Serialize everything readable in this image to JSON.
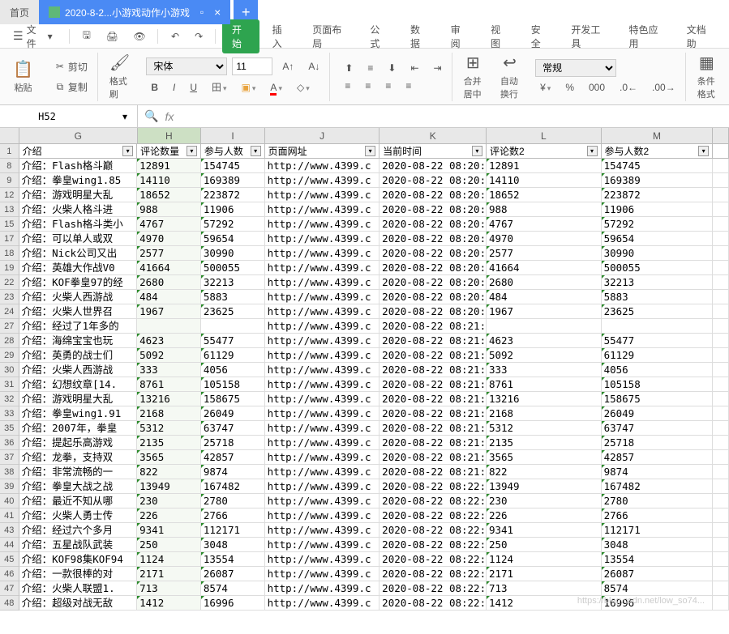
{
  "titlebar": {
    "home": "首页",
    "file_tab": "2020-8-2...小游戏动作小游戏",
    "add": "+"
  },
  "menubar": {
    "file": "文件",
    "start": "开始",
    "insert": "插入",
    "layout": "页面布局",
    "formula": "公式",
    "data": "数据",
    "review": "审阅",
    "view": "视图",
    "secure": "安全",
    "dev": "开发工具",
    "special": "特色应用",
    "dochelp": "文档助"
  },
  "ribbon": {
    "paste": "粘贴",
    "cut": "剪切",
    "copy": "复制",
    "format_painter": "格式刷",
    "font": "宋体",
    "size": "11",
    "merge": "合并居中",
    "wrap": "自动换行",
    "numfmt": "常规",
    "condfmt": "条件格式"
  },
  "formula_bar": {
    "name": "H52",
    "fx": "fx"
  },
  "columns": [
    "G",
    "H",
    "I",
    "J",
    "K",
    "L",
    "M",
    ""
  ],
  "headers": [
    "介绍",
    "评论数量",
    "参与人数",
    "页面网址",
    "当前时间",
    "评论数2",
    "参与人数2",
    ""
  ],
  "row_nums": [
    "1",
    "8",
    "9",
    "12",
    "13",
    "15",
    "17",
    "18",
    "19",
    "22",
    "23",
    "24",
    "27",
    "28",
    "29",
    "30",
    "31",
    "32",
    "33",
    "35",
    "36",
    "37",
    "38",
    "39",
    "40",
    "41",
    "43",
    "44",
    "45",
    "46",
    "47",
    "48"
  ],
  "chart_data": {
    "type": "table",
    "columns": [
      "介绍",
      "评论数量",
      "参与人数",
      "页面网址",
      "当前时间",
      "评论数2",
      "参与人数2"
    ],
    "rows": [
      [
        "介绍：Flash格斗巅",
        "12891",
        "154745",
        "http://www.4399.c",
        "2020-08-22 08:20:",
        "12891",
        "154745"
      ],
      [
        "介绍：拳皇wing1.85",
        "14110",
        "169389",
        "http://www.4399.c",
        "2020-08-22 08:20:",
        "14110",
        "169389"
      ],
      [
        "介绍：游戏明星大乱",
        "18652",
        "223872",
        "http://www.4399.c",
        "2020-08-22 08:20:",
        "18652",
        "223872"
      ],
      [
        "介绍：火柴人格斗进",
        "988",
        "11906",
        "http://www.4399.c",
        "2020-08-22 08:20:",
        "988",
        "11906"
      ],
      [
        "介绍：Flash格斗类小",
        "4767",
        "57292",
        "http://www.4399.c",
        "2020-08-22 08:20:",
        "4767",
        "57292"
      ],
      [
        "介绍：可以单人或双",
        "4970",
        "59654",
        "http://www.4399.c",
        "2020-08-22 08:20:",
        "4970",
        "59654"
      ],
      [
        "介绍：Nick公司又出",
        "2577",
        "30990",
        "http://www.4399.c",
        "2020-08-22 08:20:",
        "2577",
        "30990"
      ],
      [
        "介绍：英雄大作战V0",
        "41664",
        "500055",
        "http://www.4399.c",
        "2020-08-22 08:20:",
        "41664",
        "500055"
      ],
      [
        "介绍：KOF拳皇97的经",
        "2680",
        "32213",
        "http://www.4399.c",
        "2020-08-22 08:20:",
        "2680",
        "32213"
      ],
      [
        "介绍：火柴人西游战",
        "484",
        "5883",
        "http://www.4399.c",
        "2020-08-22 08:20:",
        "484",
        "5883"
      ],
      [
        "介绍：火柴人世界召",
        "1967",
        "23625",
        "http://www.4399.c",
        "2020-08-22 08:20:",
        "1967",
        "23625"
      ],
      [
        "介绍：经过了1年多的",
        "",
        "",
        "http://www.4399.c",
        "2020-08-22 08:21:",
        "",
        ""
      ],
      [
        "介绍：海绵宝宝也玩",
        "4623",
        "55477",
        "http://www.4399.c",
        "2020-08-22 08:21:",
        "4623",
        "55477"
      ],
      [
        "介绍：英勇的战士们",
        "5092",
        "61129",
        "http://www.4399.c",
        "2020-08-22 08:21:",
        "5092",
        "61129"
      ],
      [
        "介绍：火柴人西游战",
        "333",
        "4056",
        "http://www.4399.c",
        "2020-08-22 08:21:",
        "333",
        "4056"
      ],
      [
        "介绍：幻想纹章[14.",
        "8761",
        "105158",
        "http://www.4399.c",
        "2020-08-22 08:21:",
        "8761",
        "105158"
      ],
      [
        "介绍：游戏明星大乱",
        "13216",
        "158675",
        "http://www.4399.c",
        "2020-08-22 08:21:",
        "13216",
        "158675"
      ],
      [
        "介绍：拳皇wing1.91",
        "2168",
        "26049",
        "http://www.4399.c",
        "2020-08-22 08:21:",
        "2168",
        "26049"
      ],
      [
        "介绍：2007年，拳皇",
        "5312",
        "63747",
        "http://www.4399.c",
        "2020-08-22 08:21:",
        "5312",
        "63747"
      ],
      [
        "介绍：提起乐高游戏",
        "2135",
        "25718",
        "http://www.4399.c",
        "2020-08-22 08:21:",
        "2135",
        "25718"
      ],
      [
        "介绍：龙拳，支持双",
        "3565",
        "42857",
        "http://www.4399.c",
        "2020-08-22 08:21:",
        "3565",
        "42857"
      ],
      [
        "介绍：非常流畅的一",
        "822",
        "9874",
        "http://www.4399.c",
        "2020-08-22 08:21:",
        "822",
        "9874"
      ],
      [
        "介绍：拳皇大战之战",
        "13949",
        "167482",
        "http://www.4399.c",
        "2020-08-22 08:22:",
        "13949",
        "167482"
      ],
      [
        "介绍：最近不知从哪",
        "230",
        "2780",
        "http://www.4399.c",
        "2020-08-22 08:22:",
        "230",
        "2780"
      ],
      [
        "介绍：火柴人勇士传",
        "226",
        "2766",
        "http://www.4399.c",
        "2020-08-22 08:22:",
        "226",
        "2766"
      ],
      [
        "介绍：经过六个多月",
        "9341",
        "112171",
        "http://www.4399.c",
        "2020-08-22 08:22:",
        "9341",
        "112171"
      ],
      [
        "介绍：五星战队武装",
        "250",
        "3048",
        "http://www.4399.c",
        "2020-08-22 08:22:",
        "250",
        "3048"
      ],
      [
        "介绍：KOF98集KOF94",
        "1124",
        "13554",
        "http://www.4399.c",
        "2020-08-22 08:22:",
        "1124",
        "13554"
      ],
      [
        "介绍：一款很棒的对",
        "2171",
        "26087",
        "http://www.4399.c",
        "2020-08-22 08:22:",
        "2171",
        "26087"
      ],
      [
        "介绍：火柴人联盟1.",
        "713",
        "8574",
        "http://www.4399.c",
        "2020-08-22 08:22:",
        "713",
        "8574"
      ],
      [
        "介绍：超级对战无敌",
        "1412",
        "16996",
        "http://www.4399.c",
        "2020-08-22 08:22:",
        "1412",
        "16996"
      ]
    ]
  },
  "watermark": "https://blog.csdn.net/low_so74..."
}
